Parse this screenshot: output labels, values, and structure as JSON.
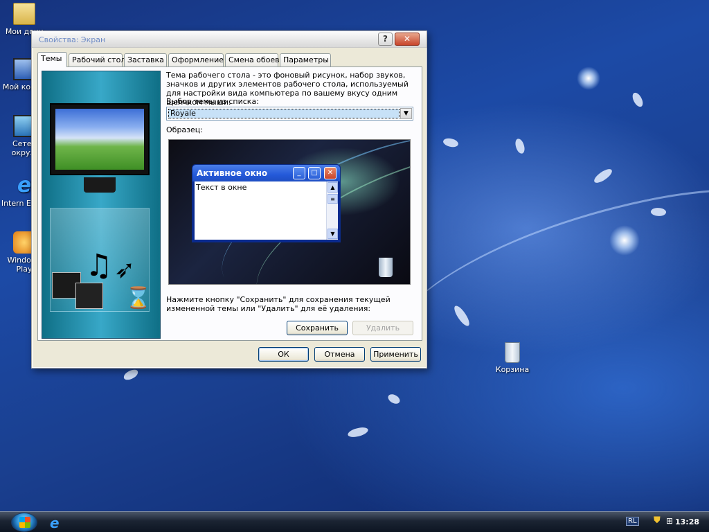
{
  "desktop": {
    "icons": [
      {
        "label": "Мои доку"
      },
      {
        "label": "Мой компь"
      },
      {
        "label": "Сетев окруж"
      },
      {
        "label": "Intern Explo"
      },
      {
        "label": "Windows Play"
      },
      {
        "label": "Корзина"
      }
    ]
  },
  "window": {
    "title": "Свойства: Экран",
    "help_btn": "?",
    "close_btn": "✕",
    "tabs": [
      "Темы",
      "Рабочий стол",
      "Заставка",
      "Оформление",
      "Смена обоев",
      "Параметры"
    ],
    "active_tab": "Темы",
    "description": "Тема рабочего стола - это фоновый рисунок, набор звуков, значков и других элементов рабочего стола, используемый для настройки вида компьютера по вашему вкусу одним щелчком мыши.",
    "theme_label": "Выбор темы из списка:",
    "theme_value": "Royale",
    "sample_label": "Образец:",
    "sample_window_title": "Активное окно",
    "sample_window_text": "Текст в окне",
    "hint": "Нажмите кнопку \"Сохранить\" для сохранения текущей измененной темы или \"Удалить\" для её удаления:",
    "save_button": "Сохранить",
    "delete_button": "Удалить",
    "ok_button": "ОК",
    "cancel_button": "Отмена",
    "apply_button": "Применить"
  },
  "taskbar": {
    "language": "RL",
    "clock": "13:28"
  },
  "colors": {
    "title_text": "#6f8cc6",
    "xp_blue_title": "#2459d9",
    "desktop_blue": "#1c4aa6"
  }
}
